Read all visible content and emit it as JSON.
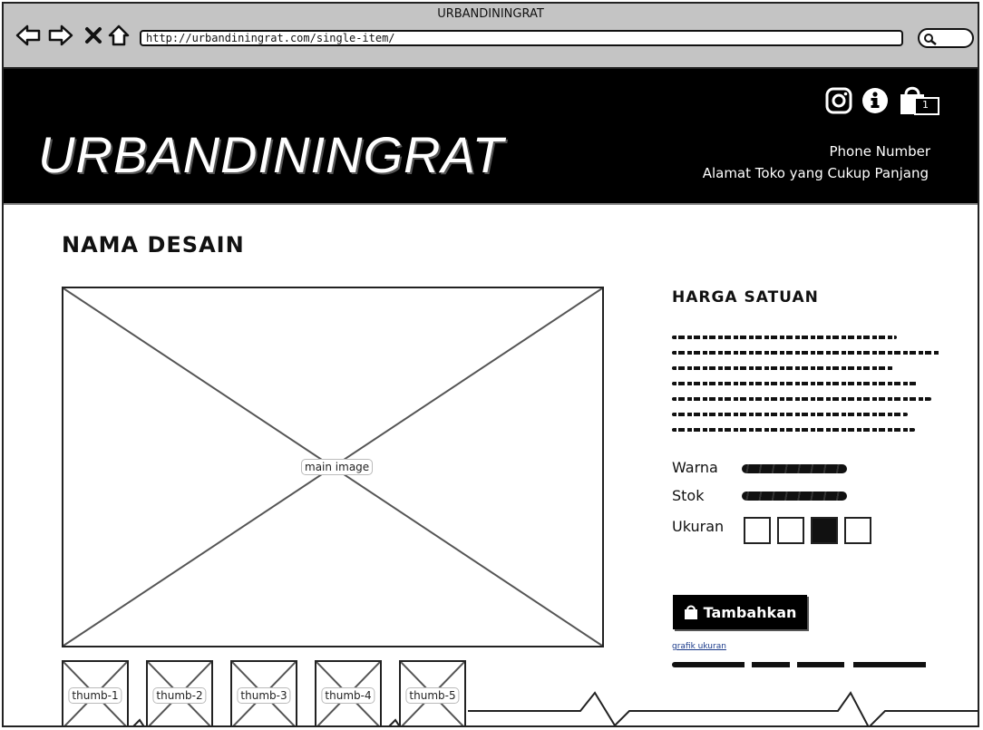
{
  "browser": {
    "window_title": "URBANDININGRAT",
    "url": "http://urbandiningrat.com/single-item/"
  },
  "header": {
    "logo": "URBANDININGRAT",
    "phone": "Phone Number",
    "address": "Alamat Toko yang Cukup Panjang",
    "cart_count": "1",
    "icons": [
      "instagram-icon",
      "info-icon",
      "cart-icon"
    ]
  },
  "product": {
    "title": "NAMA DESAIN",
    "main_image_label": "main image",
    "thumbnails": [
      "thumb-1",
      "thumb-2",
      "thumb-3",
      "thumb-4",
      "thumb-5"
    ],
    "price_title": "HARGA SATUAN",
    "warna_label": "Warna",
    "stok_label": "Stok",
    "ukuran_label": "Ukuran",
    "add_button": "Tambahkan",
    "size_chart_link": "grafik ukuran"
  },
  "colors": {
    "header_bg": "#000000",
    "chrome_bg": "#c4c4c4",
    "selected_size": "#111111"
  }
}
